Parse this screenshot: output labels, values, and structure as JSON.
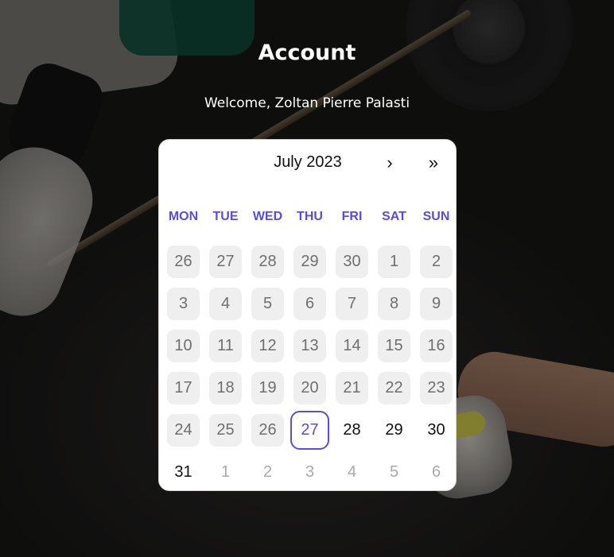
{
  "page": {
    "title": "Account",
    "welcome": "Welcome, Zoltan Pierre Palasti"
  },
  "calendar": {
    "month_label": "July 2023",
    "next_icon": "chevron-right",
    "next_label": "›",
    "next_year_icon": "double-chevron-right",
    "next_year_label": "»",
    "weekdays": [
      "MON",
      "TUE",
      "WED",
      "THU",
      "FRI",
      "SAT",
      "SUN"
    ],
    "days": [
      {
        "label": "26",
        "state": "past"
      },
      {
        "label": "27",
        "state": "past"
      },
      {
        "label": "28",
        "state": "past"
      },
      {
        "label": "29",
        "state": "past"
      },
      {
        "label": "30",
        "state": "past"
      },
      {
        "label": "1",
        "state": "past"
      },
      {
        "label": "2",
        "state": "past"
      },
      {
        "label": "3",
        "state": "past"
      },
      {
        "label": "4",
        "state": "past"
      },
      {
        "label": "5",
        "state": "past"
      },
      {
        "label": "6",
        "state": "past"
      },
      {
        "label": "7",
        "state": "past"
      },
      {
        "label": "8",
        "state": "past"
      },
      {
        "label": "9",
        "state": "past"
      },
      {
        "label": "10",
        "state": "past"
      },
      {
        "label": "11",
        "state": "past"
      },
      {
        "label": "12",
        "state": "past"
      },
      {
        "label": "13",
        "state": "past"
      },
      {
        "label": "14",
        "state": "past"
      },
      {
        "label": "15",
        "state": "past"
      },
      {
        "label": "16",
        "state": "past"
      },
      {
        "label": "17",
        "state": "past"
      },
      {
        "label": "18",
        "state": "past"
      },
      {
        "label": "19",
        "state": "past"
      },
      {
        "label": "20",
        "state": "past"
      },
      {
        "label": "21",
        "state": "past"
      },
      {
        "label": "22",
        "state": "past"
      },
      {
        "label": "23",
        "state": "past"
      },
      {
        "label": "24",
        "state": "past"
      },
      {
        "label": "25",
        "state": "past"
      },
      {
        "label": "26",
        "state": "past"
      },
      {
        "label": "27",
        "state": "today"
      },
      {
        "label": "28",
        "state": "future"
      },
      {
        "label": "29",
        "state": "future"
      },
      {
        "label": "30",
        "state": "future"
      },
      {
        "label": "31",
        "state": "future"
      },
      {
        "label": "1",
        "state": "other"
      },
      {
        "label": "2",
        "state": "other"
      },
      {
        "label": "3",
        "state": "other"
      },
      {
        "label": "4",
        "state": "other"
      },
      {
        "label": "5",
        "state": "other"
      },
      {
        "label": "6",
        "state": "other"
      }
    ]
  },
  "colors": {
    "accent": "#5a4ed4",
    "past_day_bg": "#efefef",
    "past_day_text": "#6f6f6f",
    "other_month_text": "#a9a9a9"
  }
}
